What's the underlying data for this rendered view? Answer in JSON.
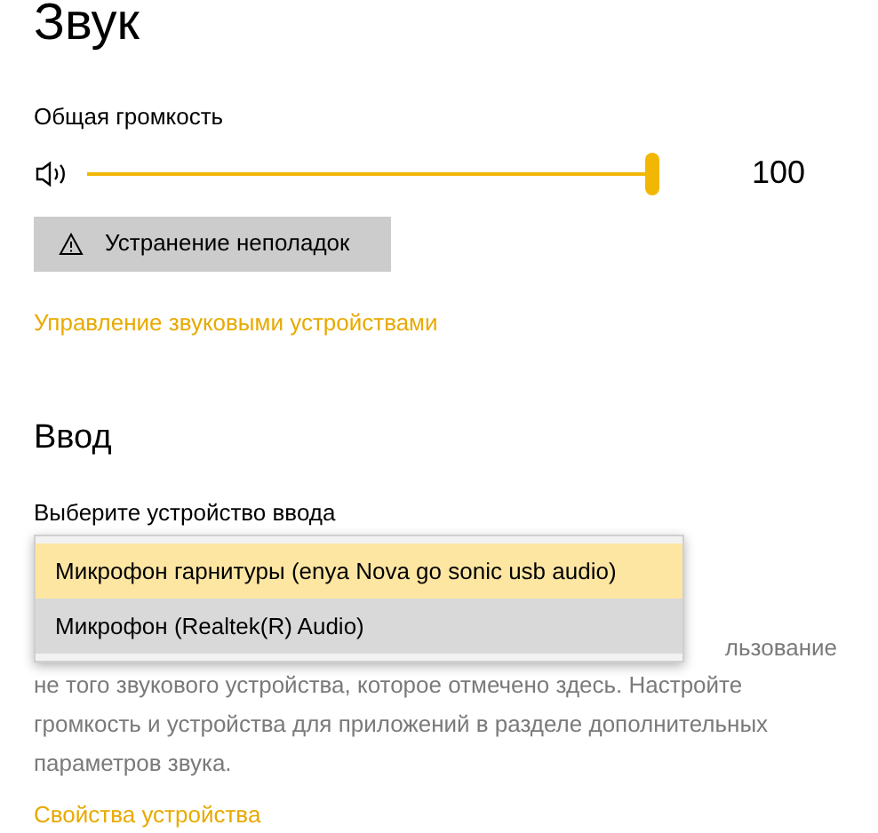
{
  "title": "Звук",
  "volume": {
    "label": "Общая громкость",
    "level": 1,
    "reading": "100"
  },
  "troubleshoot_button": {
    "label": "Устранение неполадок"
  },
  "manage_link": "Управление звуковыми устройствами",
  "input": {
    "heading": "Ввод",
    "label": "Выберите устройство ввода",
    "dropdown_options": [
      {
        "label": "Микрофон гарнитуры (enya Nova go sonic usb audio)",
        "selected": true
      },
      {
        "label": "Микрофон (Realtek(R) Audio)",
        "selected": false
      }
    ],
    "note_fragment": "льзование",
    "note": "не того звукового устройства, которое отмечено здесь. Настройте громкость и устройства для приложений в разделе дополнительных параметров звука."
  },
  "properties_link": "Свойства устройства"
}
